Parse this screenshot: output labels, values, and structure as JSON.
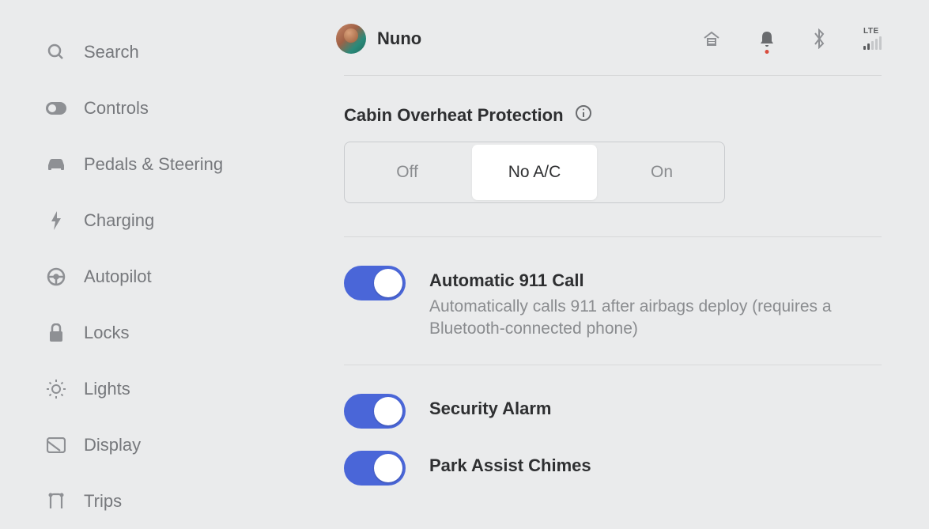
{
  "sidebar": {
    "items": [
      {
        "label": "Search",
        "icon": "search"
      },
      {
        "label": "Controls",
        "icon": "toggle"
      },
      {
        "label": "Pedals & Steering",
        "icon": "car"
      },
      {
        "label": "Charging",
        "icon": "bolt"
      },
      {
        "label": "Autopilot",
        "icon": "steering"
      },
      {
        "label": "Locks",
        "icon": "lock"
      },
      {
        "label": "Lights",
        "icon": "sun"
      },
      {
        "label": "Display",
        "icon": "display"
      },
      {
        "label": "Trips",
        "icon": "trips"
      }
    ]
  },
  "header": {
    "username": "Nuno",
    "network_type": "LTE"
  },
  "cabin_overheat": {
    "title": "Cabin Overheat Protection",
    "options": [
      "Off",
      "No A/C",
      "On"
    ],
    "selected": "No A/C"
  },
  "settings": [
    {
      "title": "Automatic 911 Call",
      "description": "Automatically calls 911 after airbags deploy (requires a Bluetooth-connected phone)",
      "on": true
    },
    {
      "title": "Security Alarm",
      "description": "",
      "on": true
    },
    {
      "title": "Park Assist Chimes",
      "description": "",
      "on": true
    }
  ]
}
